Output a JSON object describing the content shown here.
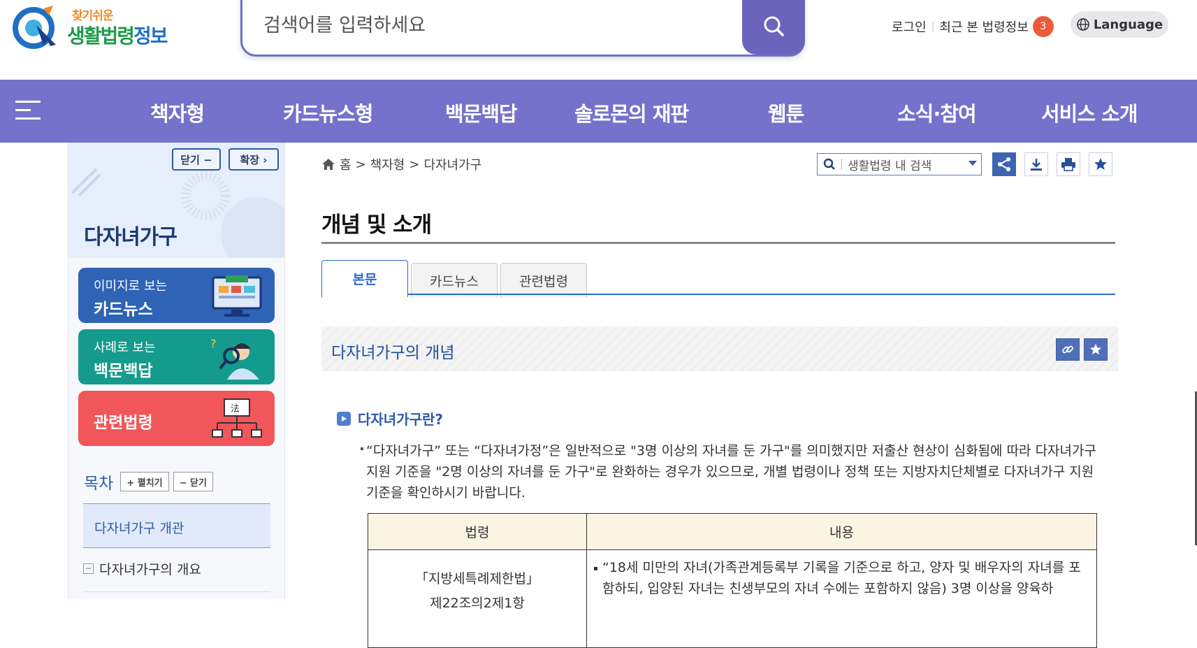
{
  "logo": {
    "small": "찾기쉬운",
    "main_a": "생활법령",
    "main_b": "정보"
  },
  "search": {
    "placeholder": "검색어를 입력하세요"
  },
  "util": {
    "login": "로그인",
    "recent": "최근 본 법령정보",
    "recent_count": "3",
    "language": "Language"
  },
  "gnb": {
    "items": [
      "책자형",
      "카드뉴스형",
      "백문백답",
      "솔로몬의 재판",
      "웹툰",
      "소식·참여",
      "서비스 소개"
    ]
  },
  "lnb": {
    "close_label": "닫기 −",
    "expand_label": "확장 ›",
    "title": "다자녀가구",
    "cards": [
      {
        "sub": "이미지로 보는",
        "main": "카드뉴스",
        "color": "#2e63b5"
      },
      {
        "sub": "사례로 보는",
        "main": "백문백답",
        "color": "#159a8e"
      },
      {
        "sub": "",
        "main": "관련법령",
        "color": "#f0565a"
      }
    ],
    "toc_title": "목차",
    "toc_expand": "+ 펼치기",
    "toc_close": "− 닫기",
    "toc_active": "다자녀가구 개관",
    "toc_item": "다자녀가구의 개요",
    "toc_minus": "−"
  },
  "breadcrumb": {
    "home": "홈",
    "level1": "책자형",
    "level2": "다자녀가구",
    "sep": ">"
  },
  "inner_search": {
    "label": "생활법령 내 검색"
  },
  "page": {
    "title": "개념 및 소개",
    "tabs": [
      "본문",
      "카드뉴스",
      "관련법령"
    ],
    "section_title": "다자녀가구의 개념",
    "sub_title": "다자녀가구란?",
    "body": "“다자녀가구” 또는 “다자녀가정”은 일반적으로 \"3명 이상의 자녀를 둔 가구\"를 의미했지만 저출산 현상이 심화됨에 따라 다자녀가구 지원 기준을 \"2명 이상의 자녀를 둔 가구\"로 완화하는 경우가 있으므로, 개별 법령이나 정책 또는 지방자치단체별로 다자녀가구 지원기준을 확인하시기 바랍니다.",
    "table": {
      "headers": [
        "법령",
        "내용"
      ],
      "row_law": "「지방세특례제한법」",
      "row_law_article": "제22조의2제1항",
      "row_content": "“18세 미만의 자녀(가족관계등록부 기록을 기준으로 하고, 양자 및 배우자의 자녀를 포함하되, 입양된 자녀는 친생부모의 자녀 수에는 포함하지 않음) 3명 이상을 양육하"
    }
  },
  "colors": {
    "gnb": "#7472cb",
    "accent": "#2d6ac9",
    "search_btn": "#6b64bd"
  }
}
